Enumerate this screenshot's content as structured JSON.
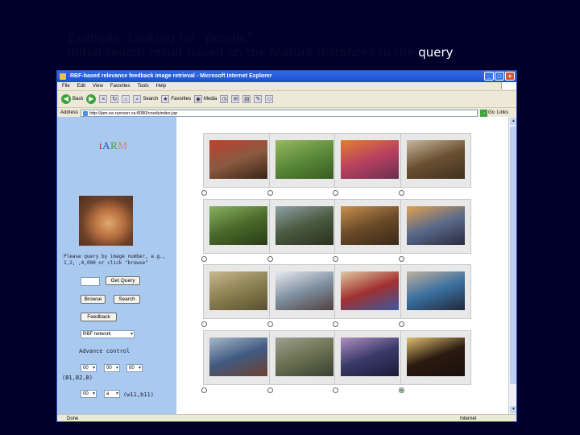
{
  "slide": {
    "caption_line1": "Example: Looking for “people”",
    "caption_line2_prefix": "Initial search result based on the feature distances to the ",
    "caption_line2_query": "query"
  },
  "window": {
    "title": "RBF-based relevance feedback image retrieval - Microsoft Internet Explorer",
    "min": "_",
    "max": "□",
    "close": "×"
  },
  "menu": [
    "File",
    "Edit",
    "View",
    "Favorites",
    "Tools",
    "Help"
  ],
  "toolbar": {
    "back": "Back",
    "search": "Search",
    "favorites": "Favorites",
    "media": "Media"
  },
  "address": {
    "label": "Address",
    "url": "http://jam.ee.ryerson.ca:8080/coedyindex.jsp",
    "go": "Go",
    "links": "Links"
  },
  "left": {
    "logo": [
      "i",
      "A",
      "R",
      "M"
    ],
    "prompt": "Please query by image number, e.g., 1,2, ,4,000 or click \"browse\"",
    "get_query": "Get Query",
    "browse": "Browse",
    "search": "Search",
    "feedback": "Feedback",
    "network_select": "RBF network",
    "advance_control": "Advance control",
    "sel_a": "00",
    "sel_b": "00",
    "sel_c": "00",
    "params1": "(B1,B2,B)",
    "sel_d": "00",
    "sel_e": "a",
    "params2": "(w11,b11)"
  },
  "status": {
    "done": "Done",
    "zone": "Internet"
  },
  "grid": [
    {
      "c1": "#8a5a40",
      "c2": "#c04030",
      "c3": "#3a2418",
      "selected": false
    },
    {
      "c1": "#5a8a3a",
      "c2": "#9ab860",
      "c3": "#3a5a20",
      "selected": false
    },
    {
      "c1": "#b84060",
      "c2": "#e08030",
      "c3": "#6a3050",
      "selected": false
    },
    {
      "c1": "#6a5030",
      "c2": "#c8b8a0",
      "c3": "#403020",
      "selected": false
    },
    {
      "c1": "#4a6a2a",
      "c2": "#8ab060",
      "c3": "#2a3a18",
      "selected": false
    },
    {
      "c1": "#4a5a40",
      "c2": "#90a0a8",
      "c3": "#2a3020",
      "selected": false
    },
    {
      "c1": "#6a4a28",
      "c2": "#c89050",
      "c3": "#3a2818",
      "selected": false
    },
    {
      "c1": "#5a6a8a",
      "c2": "#e0a050",
      "c3": "#2a2a40",
      "selected": false
    },
    {
      "c1": "#8a8050",
      "c2": "#c8b890",
      "c3": "#5a5030",
      "selected": false
    },
    {
      "c1": "#8090a0",
      "c2": "#e8e8f0",
      "c3": "#504040",
      "selected": false
    },
    {
      "c1": "#a03030",
      "c2": "#e0c8a0",
      "c3": "#3a5aa0",
      "selected": false
    },
    {
      "c1": "#3a70a0",
      "c2": "#c0b0a0",
      "c3": "#202838",
      "selected": false
    },
    {
      "c1": "#405a80",
      "c2": "#a8b8c8",
      "c3": "#704030",
      "selected": false
    },
    {
      "c1": "#6a7050",
      "c2": "#a0a090",
      "c3": "#3a4030",
      "selected": false
    },
    {
      "c1": "#3a3a6a",
      "c2": "#b090c0",
      "c3": "#1a1a3a",
      "selected": false
    },
    {
      "c1": "#2a1a10",
      "c2": "#e0c070",
      "c3": "#1a100a",
      "selected": true
    }
  ]
}
